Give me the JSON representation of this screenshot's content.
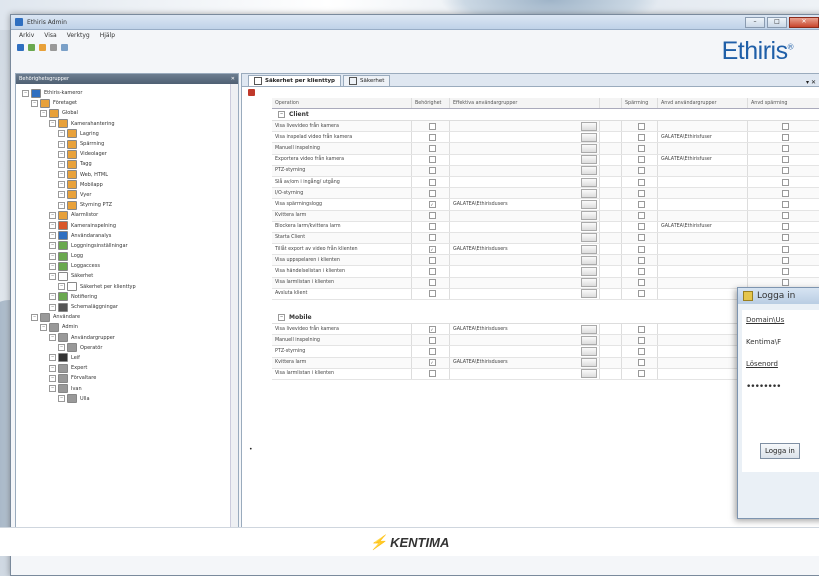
{
  "window": {
    "title": "Ethiris Admin",
    "controls": [
      "–",
      "□",
      "✕"
    ]
  },
  "brand": {
    "name": "Ethiris",
    "mark": "®"
  },
  "menu": [
    "Arkiv",
    "Visa",
    "Verktyg",
    "Hjälp"
  ],
  "left_panel": {
    "header": "Behörighetsgrupper",
    "close": "✕",
    "tree": [
      {
        "label": "Ethiris-kameror",
        "level": 0,
        "color": "#2f6fc0"
      },
      {
        "label": "Företaget",
        "level": 1,
        "color": "#e8a13a"
      },
      {
        "label": "Global",
        "level": 2,
        "color": "#e8a13a"
      },
      {
        "label": "Kamerahantering",
        "level": 3,
        "color": "#e8a13a"
      },
      {
        "label": "Lagring",
        "level": 4,
        "color": "#e8a13a"
      },
      {
        "label": "Spärrning",
        "level": 4,
        "color": "#e8a13a"
      },
      {
        "label": "Videolager",
        "level": 4,
        "color": "#e8a13a"
      },
      {
        "label": "Tagg",
        "level": 4,
        "color": "#e8a13a"
      },
      {
        "label": "Web, HTML",
        "level": 4,
        "color": "#e8a13a"
      },
      {
        "label": "Mobilapp",
        "level": 4,
        "color": "#e8a13a"
      },
      {
        "label": "Vyer",
        "level": 4,
        "color": "#e8a13a"
      },
      {
        "label": "Styrning PTZ",
        "level": 4,
        "color": "#e8a13a"
      },
      {
        "label": "Alarmlistor",
        "level": 3,
        "color": "#e8a13a"
      },
      {
        "label": "Kamerainspelning",
        "level": 3,
        "color": "#d9572a"
      },
      {
        "label": "Användaranalys",
        "level": 3,
        "color": "#2f6fc0"
      },
      {
        "label": "Loggningsinställningar",
        "level": 3,
        "color": "#6aa84f"
      },
      {
        "label": "Logg",
        "level": 3,
        "color": "#6aa84f"
      },
      {
        "label": "Loggaccess",
        "level": 3,
        "color": "#6aa84f"
      },
      {
        "label": "Säkerhet",
        "level": 3,
        "color": "#ffffff"
      },
      {
        "label": "Säkerhet per klienttyp",
        "level": 4,
        "color": "#ffffff"
      },
      {
        "label": "Notifiering",
        "level": 3,
        "color": "#6aa84f"
      },
      {
        "label": "Schemaläggningar",
        "level": 3,
        "color": "#555555"
      },
      {
        "label": "Användare",
        "level": 1,
        "color": "#999999"
      },
      {
        "label": "Admin",
        "level": 2,
        "color": "#999999"
      },
      {
        "label": "Användargrupper",
        "level": 3,
        "color": "#999999"
      },
      {
        "label": "Operatör",
        "level": 4,
        "color": "#999999"
      },
      {
        "label": "Leif",
        "level": 3,
        "color": "#333333"
      },
      {
        "label": "Expert",
        "level": 3,
        "color": "#999999"
      },
      {
        "label": "Förvaltare",
        "level": 3,
        "color": "#999999"
      },
      {
        "label": "Ivan",
        "level": 3,
        "color": "#999999"
      },
      {
        "label": "Ulla",
        "level": 4,
        "color": "#999999"
      }
    ]
  },
  "tabs": [
    "Säkerhet per klienttyp",
    "Säkerhet"
  ],
  "grid": {
    "columns": [
      "Operation",
      "Behörighet",
      "Effektiva användargrupper",
      "Spärrning",
      "Anvd användargrupper",
      "Anvd spärrning"
    ],
    "groups": [
      {
        "name": "Client",
        "rows": [
          {
            "op": "Visa livevideo från kamera",
            "chk": false,
            "users": "",
            "s": false,
            "au": "",
            "as": false
          },
          {
            "op": "Visa inspelad video från kamera",
            "chk": false,
            "users": "",
            "s": false,
            "au": "GALATEA\\Ethirisfuser",
            "as": false
          },
          {
            "op": "Manuell inspelning",
            "chk": false,
            "users": "",
            "s": false,
            "au": "",
            "as": false
          },
          {
            "op": "Exportera video från kamera",
            "chk": false,
            "users": "",
            "s": false,
            "au": "GALATEA\\Ethirisfuser",
            "as": false
          },
          {
            "op": "PTZ-styrning",
            "chk": false,
            "users": "",
            "s": false,
            "au": "",
            "as": false
          },
          {
            "op": "Slå av/om i ingång/ utgång",
            "chk": false,
            "users": "",
            "s": false,
            "au": "",
            "as": false
          },
          {
            "op": "I/O-styrning",
            "chk": false,
            "users": "",
            "s": false,
            "au": "",
            "as": false
          },
          {
            "op": "Visa spärrningslogg",
            "chk": true,
            "users": "GALATEA\\Ethirisdusers",
            "s": false,
            "au": "",
            "as": false
          },
          {
            "op": "Kvittera larm",
            "chk": false,
            "users": "",
            "s": false,
            "au": "",
            "as": false
          },
          {
            "op": "Blockera larm/kvittera larm",
            "chk": false,
            "users": "",
            "s": false,
            "au": "GALATEA\\Ethirisfuser",
            "as": false
          },
          {
            "op": "Starta Client",
            "chk": false,
            "users": "",
            "s": false,
            "au": "",
            "as": false
          },
          {
            "op": "Tillåt export av video från klienten",
            "chk": true,
            "users": "GALATEA\\Ethirisdusers",
            "s": false,
            "au": "",
            "as": false
          },
          {
            "op": "Visa uppspelaren i klienten",
            "chk": false,
            "users": "",
            "s": false,
            "au": "",
            "as": false
          },
          {
            "op": "Visa händelselistan i klienten",
            "chk": false,
            "users": "",
            "s": false,
            "au": "",
            "as": false
          },
          {
            "op": "Visa larmlistan i klienten",
            "chk": false,
            "users": "",
            "s": false,
            "au": "",
            "as": false
          },
          {
            "op": "Avsluta klient",
            "chk": false,
            "users": "",
            "s": false,
            "au": "",
            "as": false
          }
        ]
      },
      {
        "name": "Mobile",
        "rows": [
          {
            "op": "Visa livevideo från kamera",
            "chk": true,
            "users": "GALATEA\\Ethirisdusers",
            "s": false,
            "au": "",
            "as": false
          },
          {
            "op": "Manuell inspelning",
            "chk": false,
            "users": "",
            "s": false,
            "au": "",
            "as": false
          },
          {
            "op": "PTZ-styrning",
            "chk": false,
            "users": "",
            "s": false,
            "au": "",
            "as": false
          },
          {
            "op": "Kvittera larm",
            "chk": true,
            "users": "GALATEA\\Ethirisdusers",
            "s": false,
            "au": "",
            "as": false
          },
          {
            "op": "Visa larmlistan i klienten",
            "chk": false,
            "users": "",
            "s": false,
            "au": "",
            "as": false
          }
        ]
      }
    ]
  },
  "login_dialog": {
    "title": "Logga in",
    "domain_label": "Domain\\Us",
    "kentima_label": "Kentima\\F",
    "password_label": "Lösenord",
    "password_mask": "••••••••",
    "button": "Logga in"
  },
  "footer": {
    "brand": "KENTIMA",
    "bolt": "⚡"
  },
  "colors": {
    "accent": "#1f5fa8",
    "panel_header": "#566779",
    "bolt": "#f0a500"
  }
}
